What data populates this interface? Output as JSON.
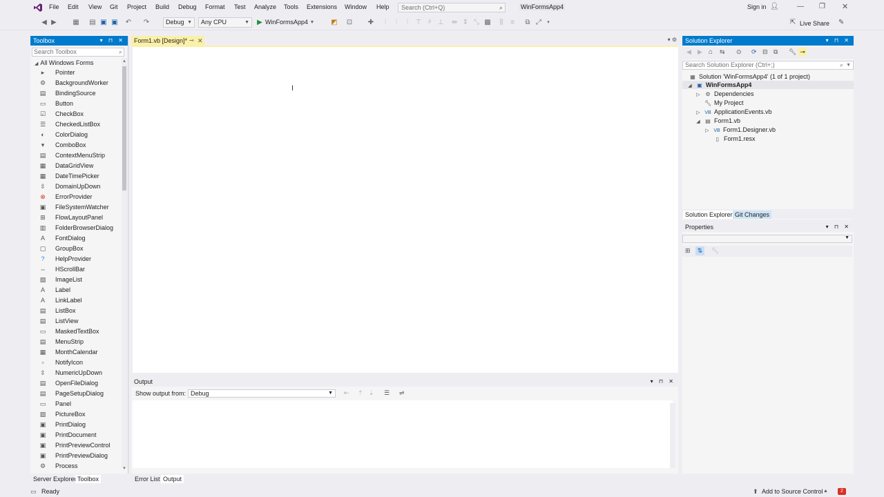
{
  "titlebar": {
    "menu": [
      "File",
      "Edit",
      "View",
      "Git",
      "Project",
      "Build",
      "Debug",
      "Format",
      "Test",
      "Analyze",
      "Tools",
      "Extensions",
      "Window",
      "Help"
    ],
    "search_placeholder": "Search (Ctrl+Q)",
    "solution_name": "WinFormsApp4",
    "sign_in": "Sign in"
  },
  "toolbar": {
    "config": "Debug",
    "platform": "Any CPU",
    "run_target": "WinFormsApp4",
    "live_share": "Live Share"
  },
  "toolbox": {
    "title": "Toolbox",
    "search_placeholder": "Search Toolbox",
    "group": "All Windows Forms",
    "items": [
      "Pointer",
      "BackgroundWorker",
      "BindingSource",
      "Button",
      "CheckBox",
      "CheckedListBox",
      "ColorDialog",
      "ComboBox",
      "ContextMenuStrip",
      "DataGridView",
      "DateTimePicker",
      "DomainUpDown",
      "ErrorProvider",
      "FileSystemWatcher",
      "FlowLayoutPanel",
      "FolderBrowserDialog",
      "FontDialog",
      "GroupBox",
      "HelpProvider",
      "HScrollBar",
      "ImageList",
      "Label",
      "LinkLabel",
      "ListBox",
      "ListView",
      "MaskedTextBox",
      "MenuStrip",
      "MonthCalendar",
      "NotifyIcon",
      "NumericUpDown",
      "OpenFileDialog",
      "PageSetupDialog",
      "Panel",
      "PictureBox",
      "PrintDialog",
      "PrintDocument",
      "PrintPreviewControl",
      "PrintPreviewDialog",
      "Process"
    ],
    "bottom_tabs": [
      "Server Explorer",
      "Toolbox"
    ]
  },
  "document": {
    "tab_label": "Form1.vb [Design]*"
  },
  "output": {
    "title": "Output",
    "show_from_label": "Show output from:",
    "source": "Debug",
    "bottom_tabs": [
      "Error List",
      "Output"
    ]
  },
  "solution_explorer": {
    "title": "Solution Explorer",
    "search_placeholder": "Search Solution Explorer (Ctrl+;)",
    "tree": [
      {
        "label": "Solution 'WinFormsApp4' (1 of 1 project)"
      },
      {
        "label": "WinFormsApp4"
      },
      {
        "label": "Dependencies"
      },
      {
        "label": "My Project"
      },
      {
        "label": "ApplicationEvents.vb"
      },
      {
        "label": "Form1.vb"
      },
      {
        "label": "Form1.Designer.vb"
      },
      {
        "label": "Form1.resx"
      }
    ],
    "tabs": [
      "Solution Explorer",
      "Git Changes"
    ]
  },
  "properties": {
    "title": "Properties"
  },
  "status": {
    "text": "Ready",
    "source_control": "Add to Source Control"
  },
  "colors": {
    "accent": "#007acc",
    "doc_tab": "#fbf0a8",
    "logo": "#68217a"
  }
}
